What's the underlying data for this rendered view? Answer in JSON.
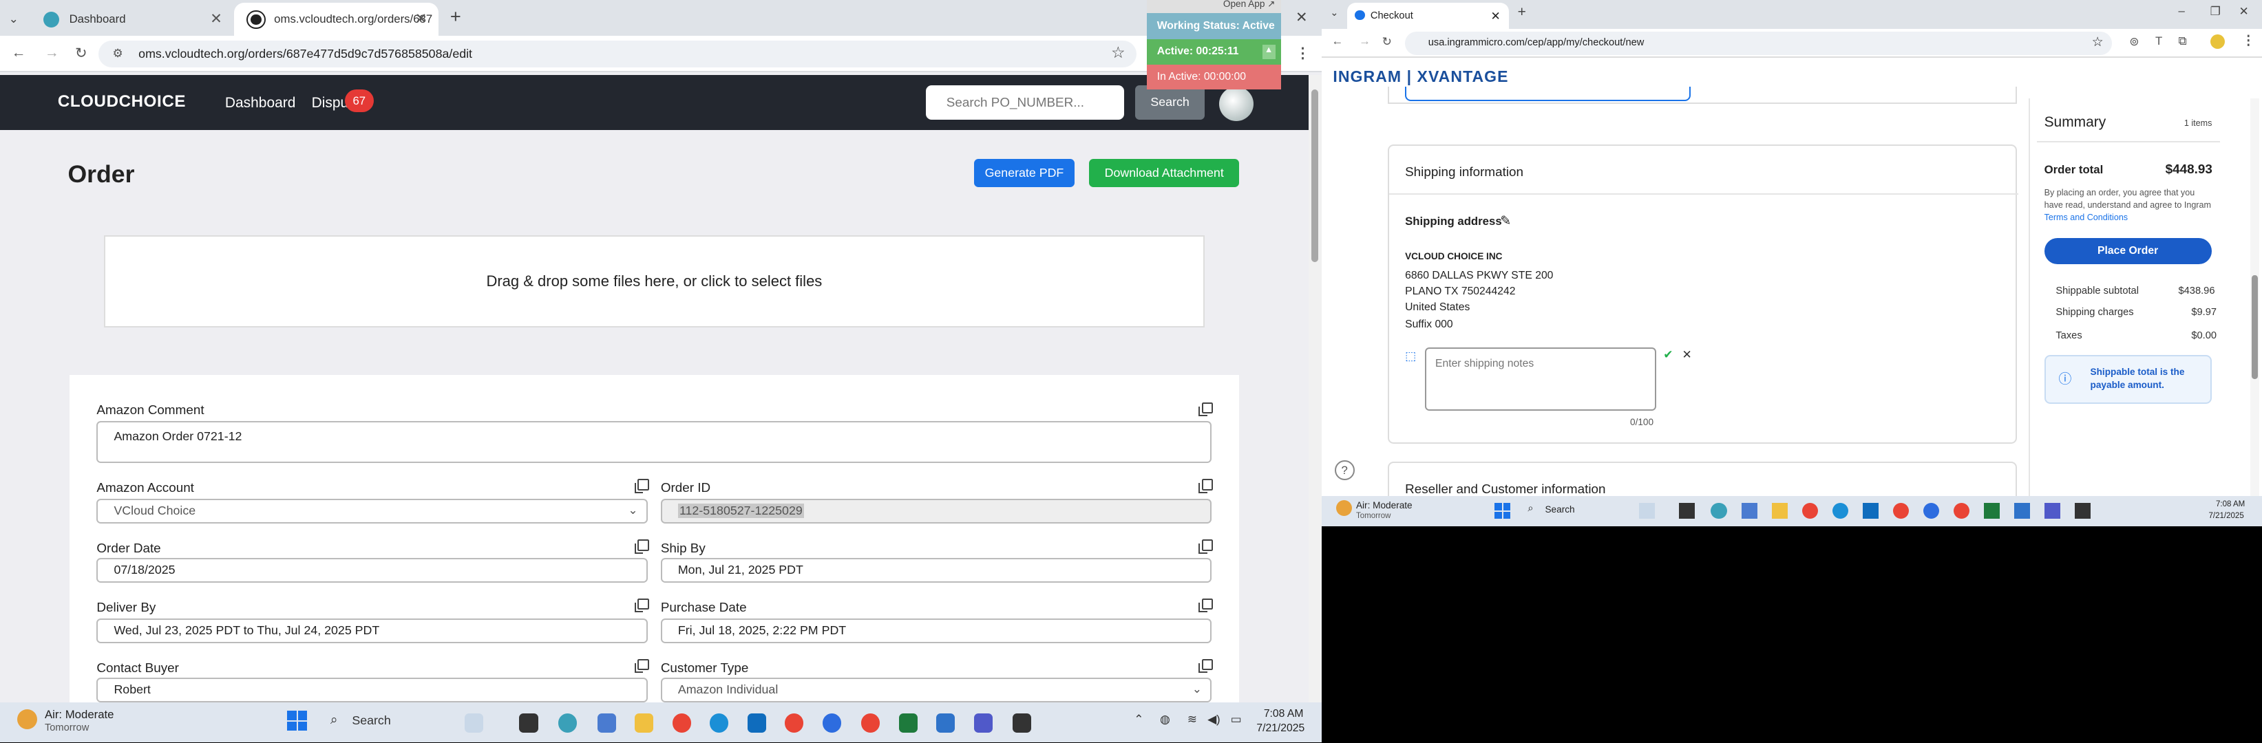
{
  "left_browser": {
    "tabs": [
      {
        "label": "Dashboard"
      },
      {
        "label": "oms.vcloudtech.org/orders/687"
      }
    ],
    "url": "oms.vcloudtech.org/orders/687e477d5d9c7d576858508a/edit",
    "app": {
      "logo": "CLOUDCHOICE",
      "nav_dashboard": "Dashboard",
      "nav_disputes": "Dispu",
      "disputes_badge": "67",
      "search_placeholder": "Search PO_NUMBER...",
      "search_button": "Search"
    },
    "order": {
      "title": "Order",
      "generate_pdf": "Generate PDF",
      "download_attachment": "Download Attachment",
      "dropzone": "Drag & drop some files here, or click to select files",
      "amazon_comment_label": "Amazon Comment",
      "amazon_comment_value": "Amazon Order 0721-12",
      "amazon_account_label": "Amazon Account",
      "amazon_account_value": "VCloud Choice",
      "order_id_label": "Order ID",
      "order_id_value": "112-5180527-1225029",
      "order_date_label": "Order Date",
      "order_date_value": "07/18/2025",
      "ship_by_label": "Ship By",
      "ship_by_value": "Mon, Jul 21, 2025 PDT",
      "deliver_by_label": "Deliver By",
      "deliver_by_value": "Wed, Jul 23, 2025 PDT to Thu, Jul 24, 2025 PDT",
      "purchase_date_label": "Purchase Date",
      "purchase_date_value": "Fri, Jul 18, 2025, 2:22 PM PDT",
      "contact_buyer_label": "Contact Buyer",
      "contact_buyer_value": "Robert",
      "customer_type_label": "Customer Type",
      "customer_type_value": "Amazon Individual"
    }
  },
  "overlay": {
    "open_app": "Open App ↗",
    "working_status": "Working Status: Active",
    "active_time": "Active: 00:25:11",
    "inactive_time": "In Active: 00:00:00"
  },
  "right_browser": {
    "tab": "Checkout",
    "url": "usa.ingrammicro.com/cep/app/my/checkout/new",
    "brand": "INGRAM | XVANTAGE",
    "shipping_info_title": "Shipping information",
    "shipping_address_label": "Shipping address",
    "address_lines": [
      "VCLOUD CHOICE INC",
      "6860 DALLAS PKWY STE 200",
      "PLANO TX 750244242",
      "United States",
      "Suffix 000"
    ],
    "notes_placeholder": "Enter shipping notes",
    "notes_count": "0/100",
    "reseller_title": "Reseller and Customer information",
    "summary": {
      "title": "Summary",
      "items": "1 items",
      "order_total_label": "Order total",
      "order_total_value": "$448.93",
      "terms_text": "By placing an order, you agree that you have read, understand and agree to Ingram",
      "terms_link": "Terms and Conditions",
      "place_order": "Place Order",
      "shippable_subtotal_label": "Shippable subtotal",
      "shippable_subtotal_value": "$438.96",
      "shipping_charges_label": "Shipping charges",
      "shipping_charges_value": "$9.97",
      "taxes_label": "Taxes",
      "taxes_value": "$0.00",
      "info_text": "Shippable total is the payable amount."
    }
  },
  "taskbar_left": {
    "weather": "Air: Moderate",
    "weather_sub": "Tomorrow",
    "search": "Search",
    "time": "7:08 AM",
    "date": "7/21/2025"
  },
  "taskbar_right": {
    "weather": "Air: Moderate",
    "weather_sub": "Tomorrow",
    "search": "Search",
    "time": "7:08 AM",
    "date": "7/21/2025"
  },
  "colors": {
    "accent_blue": "#1a73e8",
    "green": "#22b04b",
    "dark_nav": "#23272f"
  }
}
